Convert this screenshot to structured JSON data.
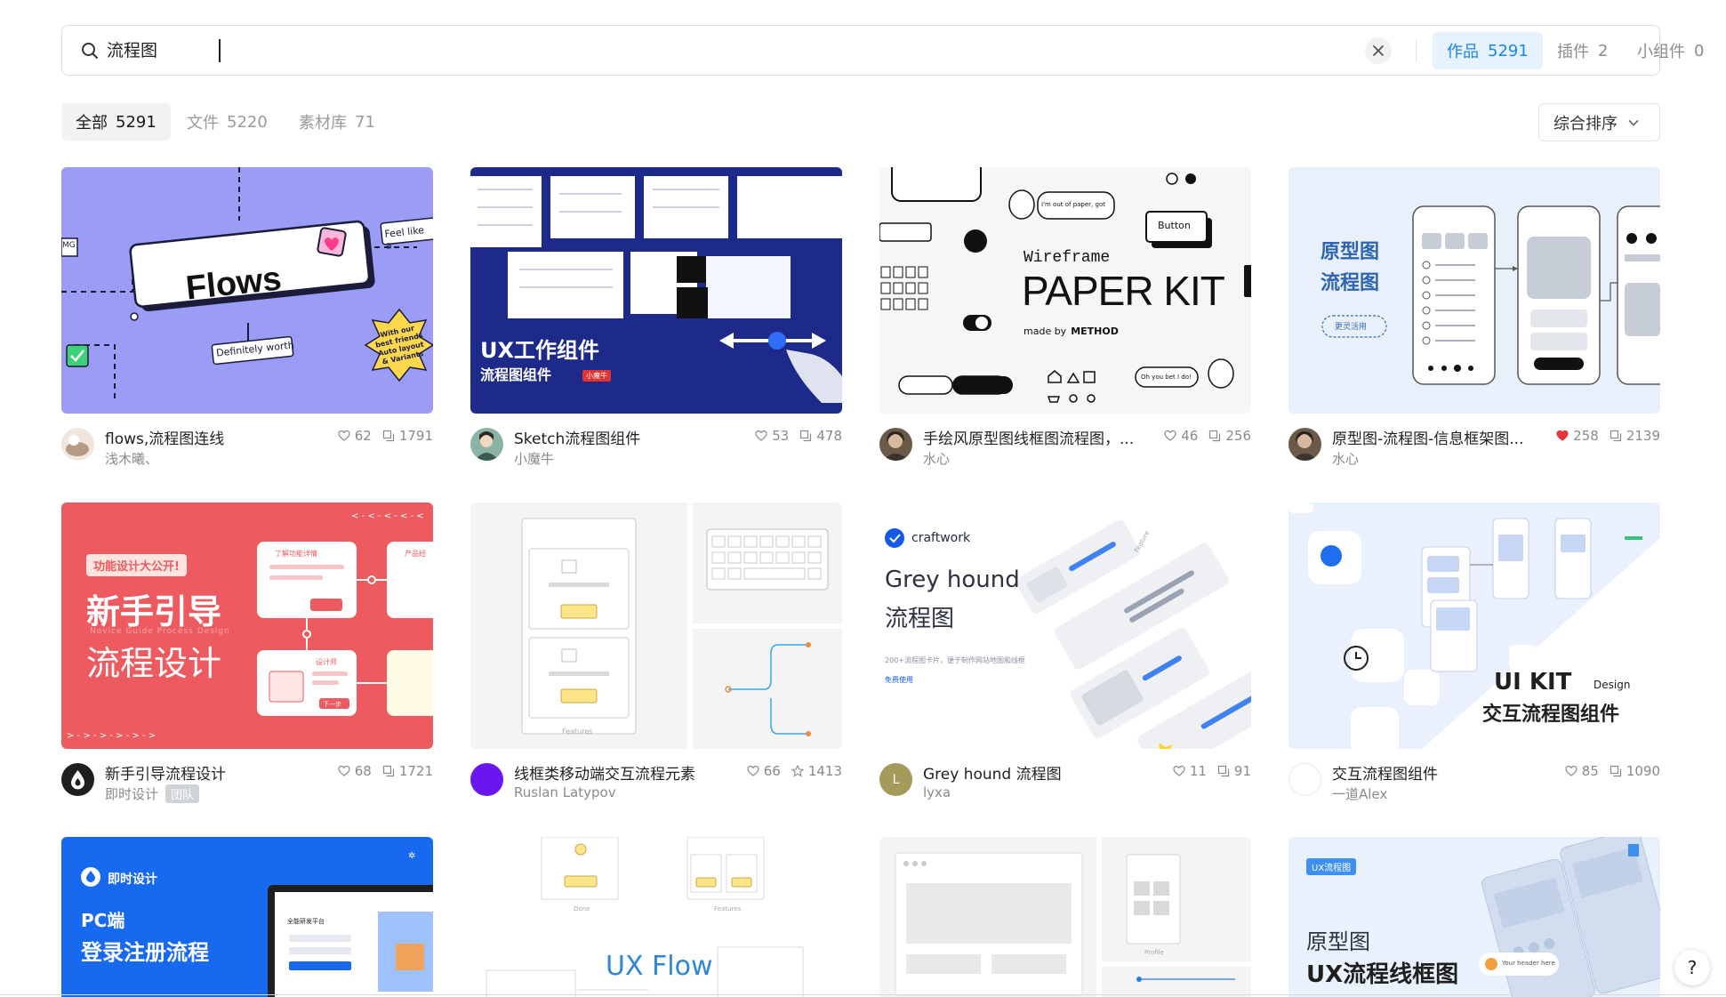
{
  "search": {
    "value": "流程图",
    "clear_label": "✕"
  },
  "type_tabs": [
    {
      "label": "作品",
      "count": "5291"
    },
    {
      "label": "插件",
      "count": "2"
    },
    {
      "label": "小组件",
      "count": "0"
    }
  ],
  "filter_tabs": [
    {
      "label": "全部",
      "count": "5291"
    },
    {
      "label": "文件",
      "count": "5220"
    },
    {
      "label": "素材库",
      "count": "71"
    }
  ],
  "sort": {
    "label": "综合排序"
  },
  "colors": {
    "accent": "#1a84ef",
    "accent_bg": "#e6f3ff",
    "liked_heart": "#e8353b"
  },
  "cards": [
    {
      "title": "flows,流程图连线",
      "author": "浅木曦、",
      "likes": "62",
      "views": "1791",
      "views_icon": "copy-icon",
      "thumb": {
        "main": "Flows",
        "tag1": "Feel like a",
        "tag2": "Definitely worth",
        "badge": "With our best friends Auto layout & Variants",
        "tag3": "MG"
      }
    },
    {
      "title": "Sketch流程图组件",
      "author": "小魔牛",
      "likes": "53",
      "views": "478",
      "views_icon": "copy-icon",
      "thumb": {
        "line1": "UX工作组件",
        "line2": "流程图组件",
        "tag": "小魔牛"
      }
    },
    {
      "title": "手绘风原型图线框图流程图，...",
      "author": "水心",
      "likes": "46",
      "views": "256",
      "views_icon": "copy-icon",
      "thumb": {
        "l1": "Wireframe",
        "l2": "PAPER KIT",
        "l3": "made by",
        "l4": "METHOD",
        "button": "Button",
        "bubble1": "I'm out of paper, got",
        "bubble2": "Oh you bet I do!"
      }
    },
    {
      "title": "原型图-流程图-信息框架图...",
      "author": "水心",
      "likes": "258",
      "views": "2139",
      "liked": true,
      "views_icon": "copy-icon",
      "thumb": {
        "l1": "原型图",
        "l2": "流程图",
        "tag": "更灵活用"
      }
    },
    {
      "title": "新手引导流程设计",
      "author": "即时设计",
      "team": "团队",
      "likes": "68",
      "views": "1721",
      "views_icon": "copy-icon",
      "thumb": {
        "tag": "功能设计大公开!",
        "l1": "新手引导",
        "sub": "Novice Guide Process Design",
        "l2": "流程设计",
        "c1": "了解功能详情",
        "c2": "产品经",
        "c3": "设计师",
        "btn": "下一步"
      }
    },
    {
      "title": "线框类移动端交互流程元素",
      "author": "Ruslan Latypov",
      "likes": "66",
      "views": "1413",
      "views_icon": "star-icon",
      "thumb": {
        "label": "Features"
      }
    },
    {
      "title": "Grey hound 流程图",
      "author": "lyxa",
      "likes": "11",
      "views": "91",
      "views_icon": "copy-icon",
      "thumb": {
        "brand": "craftwork",
        "l1": "Grey hound",
        "l2": "流程图",
        "desc": "200+流程图卡片，便于制作网站地图和线框",
        "link": "免费使用",
        "feature": "Feature"
      }
    },
    {
      "title": "交互流程图组件",
      "author": "一道Alex",
      "likes": "85",
      "views": "1090",
      "views_icon": "copy-icon",
      "thumb": {
        "l1": "UI KIT",
        "l2": "Design",
        "l3": "交互流程图组件"
      }
    },
    {
      "thumb": {
        "brand": "即时设计",
        "l1": "PC端",
        "l2": "登录注册流程",
        "screen": "全能研发平台"
      }
    },
    {
      "thumb": {
        "l1": "UX Flow",
        "done": "Done",
        "features": "Features"
      }
    },
    {
      "thumb": {
        "profile": "Profile"
      }
    },
    {
      "thumb": {
        "tag": "UX流程图",
        "l1": "原型图",
        "l2": "UX流程线框图",
        "caption": "Your header here"
      }
    }
  ]
}
